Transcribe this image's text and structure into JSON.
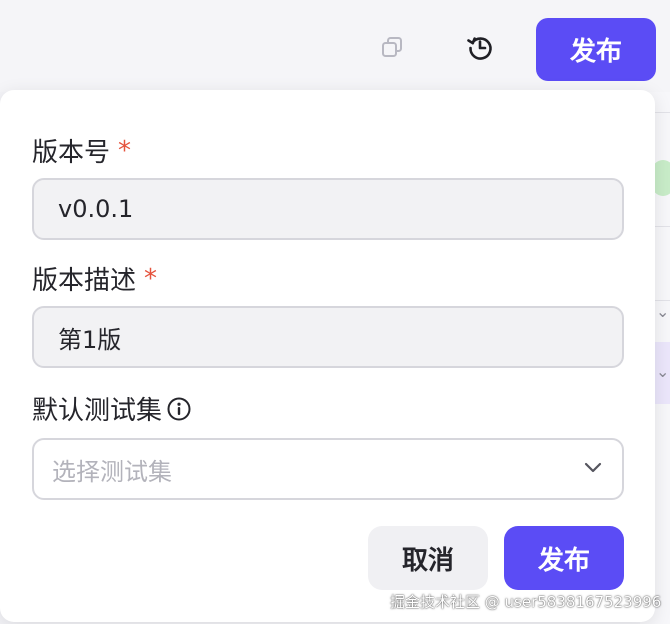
{
  "toolbar": {
    "copy_icon": "copy-icon",
    "history_icon": "history-icon",
    "publish_label": "发布"
  },
  "dialog": {
    "version": {
      "label": "版本号",
      "required_mark": "*",
      "value": "v0.0.1"
    },
    "description": {
      "label": "版本描述",
      "required_mark": "*",
      "value": "第1版"
    },
    "test_set": {
      "label": "默认测试集",
      "info_icon": "info-icon",
      "placeholder": "选择测试集",
      "chevron_icon": "chevron-down-icon"
    },
    "cancel_label": "取消",
    "publish_label": "发布"
  },
  "watermark": "掘金技术社区 @ user5838167523996",
  "colors": {
    "accent": "#5b4cf5",
    "required": "#e5533d",
    "input_bg": "#f2f2f4",
    "border": "#d6d6dc"
  }
}
